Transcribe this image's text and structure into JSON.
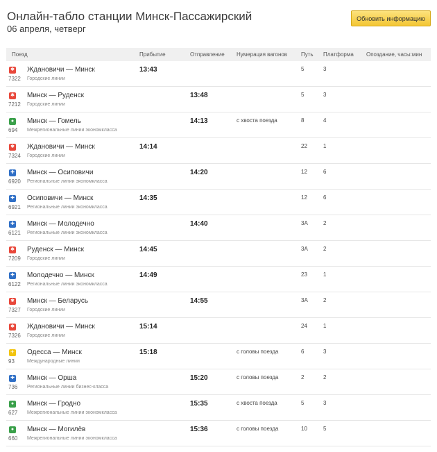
{
  "header": {
    "title": "Онлайн-табло станции Минск-Пассажирский",
    "date": "06 апреля, четверг",
    "refresh_label": "Обновить информацию"
  },
  "columns": {
    "train": "Поезд",
    "arrival": "Прибытие",
    "departure": "Отправление",
    "cars": "Нумерация вагонов",
    "track": "Путь",
    "platform": "Платформа",
    "delay": "Опоздание, часы:мин"
  },
  "colors": {
    "city": "#e8473a",
    "interregional": "#3aa04a",
    "regional": "#2f6fc6",
    "international": "#f2c40f"
  },
  "rows": [
    {
      "icon": "city-lines-icon",
      "type": "city",
      "num": "7322",
      "route": "Ждановичи — Минск",
      "cat": "Городские линии",
      "arr": "13:43",
      "dep": "",
      "cars": "",
      "track": "5",
      "plat": "3"
    },
    {
      "icon": "city-lines-icon",
      "type": "city",
      "num": "7212",
      "route": "Минск — Руденск",
      "cat": "Городские линии",
      "arr": "",
      "dep": "13:48",
      "cars": "",
      "track": "5",
      "plat": "3"
    },
    {
      "icon": "interregional-economy-icon",
      "type": "interregional",
      "num": "694",
      "route": "Минск — Гомель",
      "cat": "Межрегиональные линии экономкласса",
      "arr": "",
      "dep": "14:13",
      "cars": "с хвоста поезда",
      "track": "8",
      "plat": "4"
    },
    {
      "icon": "city-lines-icon",
      "type": "city",
      "num": "7324",
      "route": "Ждановичи — Минск",
      "cat": "Городские линии",
      "arr": "14:14",
      "dep": "",
      "cars": "",
      "track": "22",
      "plat": "1"
    },
    {
      "icon": "regional-economy-icon",
      "type": "regional",
      "num": "6920",
      "route": "Минск — Осиповичи",
      "cat": "Региональные линии экономкласса",
      "arr": "",
      "dep": "14:20",
      "cars": "",
      "track": "12",
      "plat": "6"
    },
    {
      "icon": "regional-economy-icon",
      "type": "regional",
      "num": "6921",
      "route": "Осиповичи — Минск",
      "cat": "Региональные линии экономкласса",
      "arr": "14:35",
      "dep": "",
      "cars": "",
      "track": "12",
      "plat": "6"
    },
    {
      "icon": "regional-economy-icon",
      "type": "regional",
      "num": "6121",
      "route": "Минск — Молодечно",
      "cat": "Региональные линии экономкласса",
      "arr": "",
      "dep": "14:40",
      "cars": "",
      "track": "3А",
      "plat": "2"
    },
    {
      "icon": "city-lines-icon",
      "type": "city",
      "num": "7209",
      "route": "Руденск — Минск",
      "cat": "Городские линии",
      "arr": "14:45",
      "dep": "",
      "cars": "",
      "track": "3А",
      "plat": "2"
    },
    {
      "icon": "regional-economy-icon",
      "type": "regional",
      "num": "6122",
      "route": "Молодечно — Минск",
      "cat": "Региональные линии экономкласса",
      "arr": "14:49",
      "dep": "",
      "cars": "",
      "track": "23",
      "plat": "1"
    },
    {
      "icon": "city-lines-icon",
      "type": "city",
      "num": "7327",
      "route": "Минск — Беларусь",
      "cat": "Городские линии",
      "arr": "",
      "dep": "14:55",
      "cars": "",
      "track": "3А",
      "plat": "2"
    },
    {
      "icon": "city-lines-icon",
      "type": "city",
      "num": "7326",
      "route": "Ждановичи — Минск",
      "cat": "Городские линии",
      "arr": "15:14",
      "dep": "",
      "cars": "",
      "track": "24",
      "plat": "1"
    },
    {
      "icon": "international-lines-icon",
      "type": "international",
      "num": "93",
      "route": "Одесса — Минск",
      "cat": "Международные линии",
      "arr": "15:18",
      "dep": "",
      "cars": "с головы поезда",
      "track": "6",
      "plat": "3"
    },
    {
      "icon": "regional-business-icon",
      "type": "regional",
      "num": "736",
      "route": "Минск — Орша",
      "cat": "Региональные линии бизнес-класса",
      "arr": "",
      "dep": "15:20",
      "cars": "с головы поезда",
      "track": "2",
      "plat": "2"
    },
    {
      "icon": "interregional-economy-icon",
      "type": "interregional",
      "num": "627",
      "route": "Минск — Гродно",
      "cat": "Межрегиональные линии экономкласса",
      "arr": "",
      "dep": "15:35",
      "cars": "с хвоста поезда",
      "track": "5",
      "plat": "3"
    },
    {
      "icon": "interregional-economy-icon",
      "type": "interregional",
      "num": "660",
      "route": "Минск — Могилёв",
      "cat": "Межрегиональные линии экономкласса",
      "arr": "",
      "dep": "15:36",
      "cars": "с головы поезда",
      "track": "10",
      "plat": "5"
    }
  ]
}
